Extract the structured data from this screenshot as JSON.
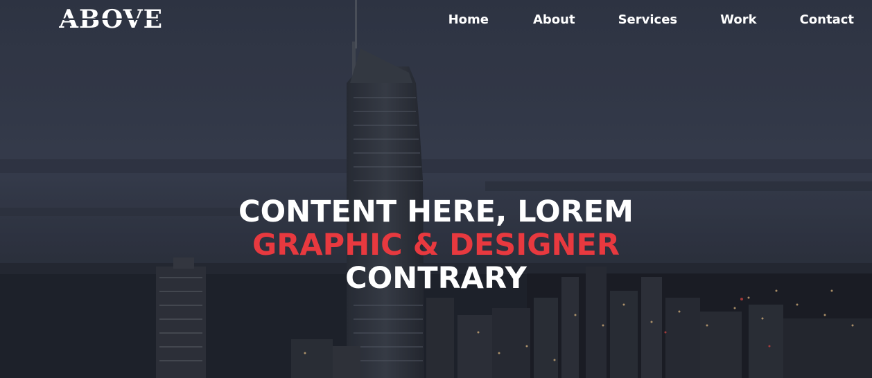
{
  "header": {
    "logo_text": "ABOVE"
  },
  "nav": {
    "items": [
      {
        "label": "Home"
      },
      {
        "label": "About"
      },
      {
        "label": "Services"
      },
      {
        "label": "Work"
      },
      {
        "label": "Contact"
      }
    ]
  },
  "hero": {
    "line1": "CONTENT HERE, LOREM",
    "line2": "GRAPHIC & DESIGNER",
    "line3": "CONTRARY"
  },
  "colors": {
    "accent": "#e8393f",
    "text": "#ffffff",
    "background": "#363d4d"
  }
}
